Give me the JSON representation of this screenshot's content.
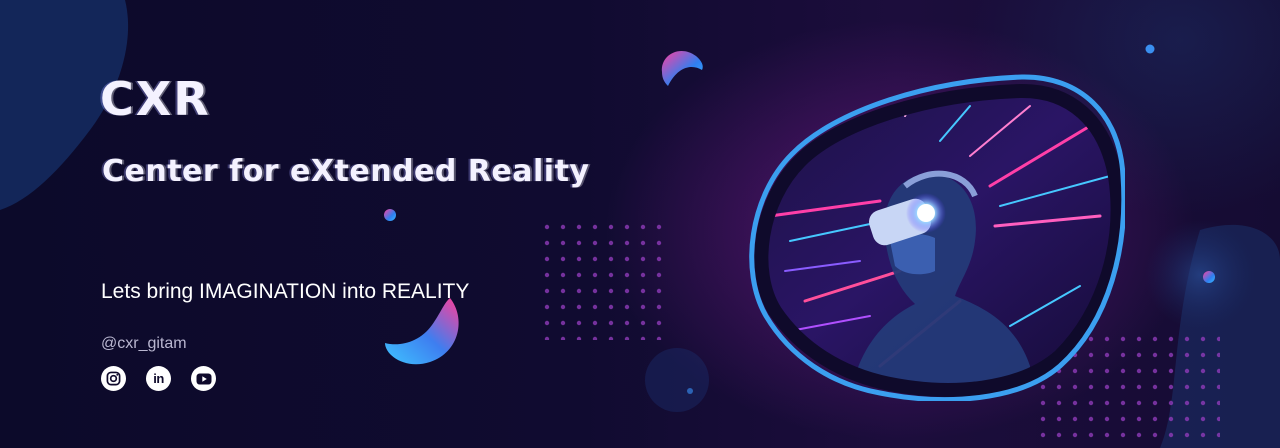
{
  "brand": {
    "title": "CXR",
    "subtitle": "Center for eXtended Reality"
  },
  "tagline": "Lets bring IMAGINATION into REALITY",
  "handle": "@cxr_gitam",
  "socials": [
    {
      "icon": "instagram-icon"
    },
    {
      "icon": "linkedin-icon",
      "text": "in"
    },
    {
      "icon": "youtube-icon"
    }
  ],
  "colors": {
    "background": "#0f0a2b",
    "accent_blue": "#3aa0f0",
    "accent_pink": "#e0339a",
    "frame_stroke": "#3b9ff0",
    "text": "#ffffff"
  }
}
